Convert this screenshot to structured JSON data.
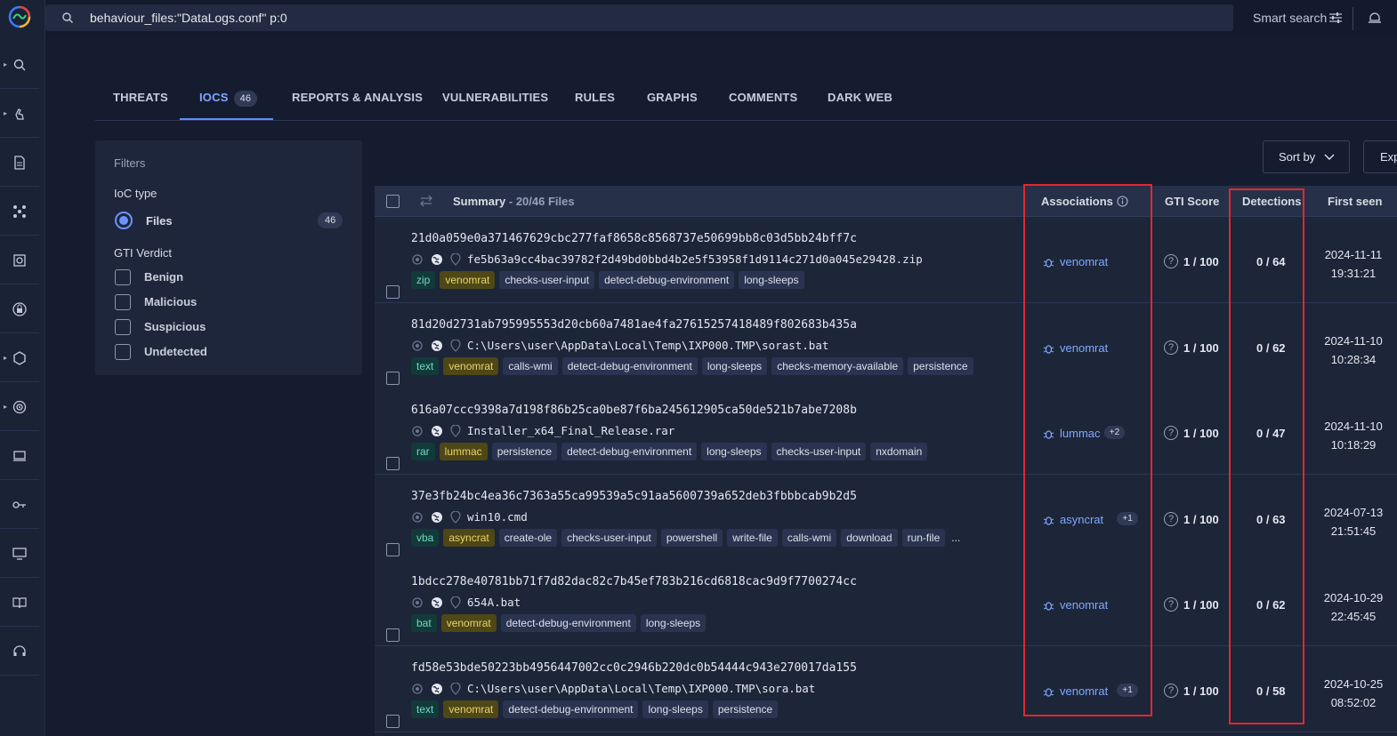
{
  "search": {
    "query": "behaviour_files:\"DataLogs.conf\" p:0",
    "smart_search_label": "Smart search"
  },
  "tabs": [
    {
      "label": "THREATS"
    },
    {
      "label": "IOCS",
      "badge": "46"
    },
    {
      "label": "REPORTS & ANALYSIS"
    },
    {
      "label": "VULNERABILITIES"
    },
    {
      "label": "RULES"
    },
    {
      "label": "GRAPHS"
    },
    {
      "label": "COMMENTS"
    },
    {
      "label": "DARK WEB"
    }
  ],
  "filters": {
    "title": "Filters",
    "ioc_type_label": "IoC type",
    "files_label": "Files",
    "files_count": "46",
    "verdict_label": "GTI Verdict",
    "verdicts": [
      "Benign",
      "Malicious",
      "Suspicious",
      "Undetected"
    ]
  },
  "toolbar": {
    "sort_label": "Sort by",
    "export_label": "Exp"
  },
  "table": {
    "summary_label": "Summary",
    "summary_sub": "- 20/46 Files",
    "col_associations": "Associations",
    "col_gti": "GTI Score",
    "col_detections": "Detections",
    "col_first_seen": "First seen",
    "rows": [
      {
        "hash": "21d0a059e0a371467629cbc277faf8658c8568737e50699bb8c03d5bb24bff7c",
        "filename": "fe5b63a9cc4bac39782f2d49bd0bbd4b2e5f53958f1d9114c271d0a045e29428.zip",
        "filetype": "zip",
        "family": "venomrat",
        "tags": [
          "checks-user-input",
          "detect-debug-environment",
          "long-sleeps"
        ],
        "assoc": "venomrat",
        "assoc_badge": "",
        "gti": "1 / 100",
        "detections": "0 / 64",
        "date": "2024-11-11",
        "time": "19:31:21"
      },
      {
        "hash": "81d20d2731ab795995553d20cb60a7481ae4fa27615257418489f802683b435a",
        "filename": "C:\\Users\\user\\AppData\\Local\\Temp\\IXP000.TMP\\sorast.bat",
        "filetype": "text",
        "family": "venomrat",
        "tags": [
          "calls-wmi",
          "detect-debug-environment",
          "long-sleeps",
          "checks-memory-available",
          "persistence"
        ],
        "assoc": "venomrat",
        "assoc_badge": "",
        "gti": "1 / 100",
        "detections": "0 / 62",
        "date": "2024-11-10",
        "time": "10:28:34"
      },
      {
        "hash": "616a07ccc9398a7d198f86b25ca0be87f6ba245612905ca50de521b7abe7208b",
        "filename": "Installer_x64_Final_Release.rar",
        "filetype": "rar",
        "family": "lummac",
        "tags": [
          "persistence",
          "detect-debug-environment",
          "long-sleeps",
          "checks-user-input",
          "nxdomain"
        ],
        "assoc": "lummac",
        "assoc_badge": "+2",
        "gti": "1 / 100",
        "detections": "0 / 47",
        "date": "2024-11-10",
        "time": "10:18:29"
      },
      {
        "hash": "37e3fb24bc4ea36c7363a55ca99539a5c91aa5600739a652deb3fbbbcab9b2d5",
        "filename": "win10.cmd",
        "filetype": "vba",
        "family": "asyncrat",
        "tags": [
          "create-ole",
          "checks-user-input",
          "powershell",
          "write-file",
          "calls-wmi",
          "download",
          "run-file"
        ],
        "more": "...",
        "assoc": "asyncrat",
        "assoc_badge": "+1",
        "gti": "1 / 100",
        "detections": "0 / 63",
        "date": "2024-07-13",
        "time": "21:51:45"
      },
      {
        "hash": "1bdcc278e40781bb71f7d82dac82c7b45ef783b216cd6818cac9d9f7700274cc",
        "filename": "654A.bat",
        "filetype": "bat",
        "family": "venomrat",
        "tags": [
          "detect-debug-environment",
          "long-sleeps"
        ],
        "assoc": "venomrat",
        "assoc_badge": "",
        "gti": "1 / 100",
        "detections": "0 / 62",
        "date": "2024-10-29",
        "time": "22:45:45"
      },
      {
        "hash": "fd58e53bde50223bb4956447002cc0c2946b220dc0b54444c943e270017da155",
        "filename": "C:\\Users\\user\\AppData\\Local\\Temp\\IXP000.TMP\\sora.bat",
        "filetype": "text",
        "family": "venomrat",
        "tags": [
          "detect-debug-environment",
          "long-sleeps",
          "persistence"
        ],
        "assoc": "venomrat",
        "assoc_badge": "+1",
        "gti": "1 / 100",
        "detections": "0 / 58",
        "date": "2024-10-25",
        "time": "08:52:02"
      }
    ]
  },
  "colors": {
    "accent": "#7fa8ff",
    "highlight": "#e0282e",
    "family_tag": "#ecd36c",
    "filetype_tag": "#6fd8c2"
  }
}
